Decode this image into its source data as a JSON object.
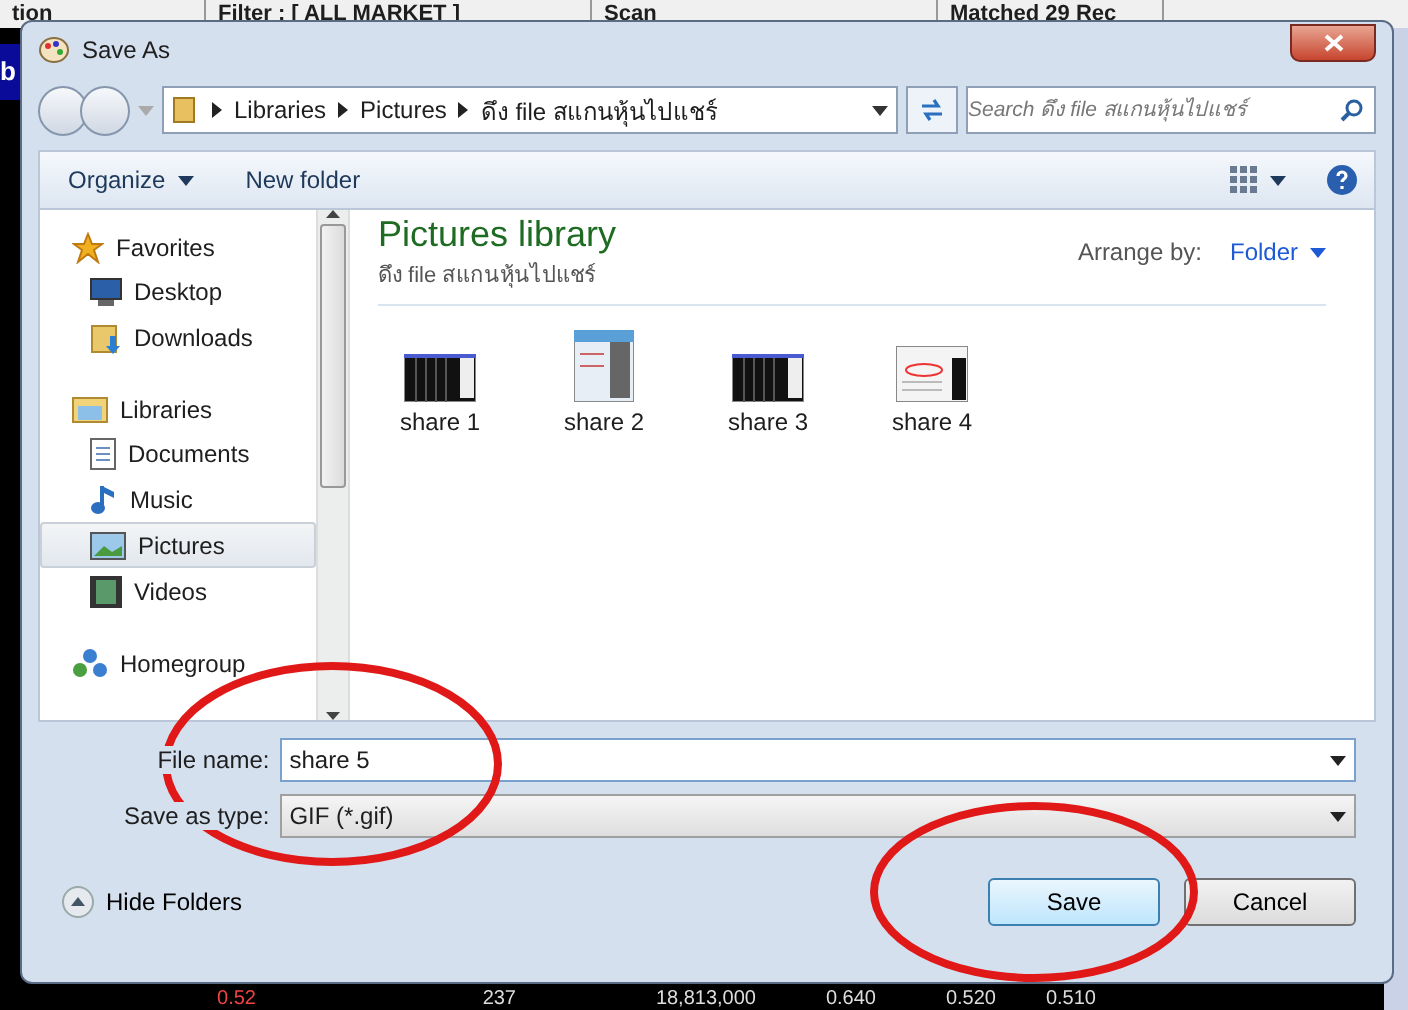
{
  "background_app": {
    "top_bar": [
      "tion",
      "Filter : [ ALL MARKET ]",
      "Scan",
      "Matched 29 Rec"
    ],
    "side_letter": "b",
    "bottom_row": [
      "0.52",
      "237",
      "18,813,000",
      "0.640",
      "0.520",
      "0.510"
    ]
  },
  "window": {
    "title": "Save As"
  },
  "address_bar": {
    "path": [
      "Libraries",
      "Pictures",
      "ดึง file สแกนหุ้นไปแชร์"
    ]
  },
  "search": {
    "placeholder": "Search ดึง file สแกนหุ้นไปแชร์"
  },
  "toolbar": {
    "organize": "Organize",
    "new_folder": "New folder"
  },
  "sidebar": {
    "groups": [
      {
        "label": "Favorites",
        "kind": "star",
        "children": [
          {
            "label": "Desktop",
            "kind": "desktop",
            "selected": false
          },
          {
            "label": "Downloads",
            "kind": "downloads",
            "selected": false
          }
        ]
      },
      {
        "label": "Libraries",
        "kind": "libraries",
        "children": [
          {
            "label": "Documents",
            "kind": "documents",
            "selected": false
          },
          {
            "label": "Music",
            "kind": "music",
            "selected": false
          },
          {
            "label": "Pictures",
            "kind": "pictures",
            "selected": true
          },
          {
            "label": "Videos",
            "kind": "videos",
            "selected": false
          }
        ]
      },
      {
        "label": "Homegroup",
        "kind": "homegroup"
      }
    ]
  },
  "library": {
    "title": "Pictures library",
    "subtitle": "ดึง file สแกนหุ้นไปแชร์",
    "arrange_label": "Arrange by:",
    "arrange_value": "Folder"
  },
  "files": [
    {
      "name": "share 1",
      "kind": "dark"
    },
    {
      "name": "share 2",
      "kind": "tall"
    },
    {
      "name": "share 3",
      "kind": "dark"
    },
    {
      "name": "share 4",
      "kind": "light"
    }
  ],
  "form": {
    "file_name": {
      "label": "File name:",
      "value": "share 5"
    },
    "save_as_type": {
      "label": "Save as type:",
      "value": "GIF (*.gif)"
    }
  },
  "hide_folders": "Hide Folders",
  "buttons": [
    {
      "label": "Save",
      "kind": "primary"
    },
    {
      "label": "Cancel",
      "kind": "normal"
    }
  ]
}
